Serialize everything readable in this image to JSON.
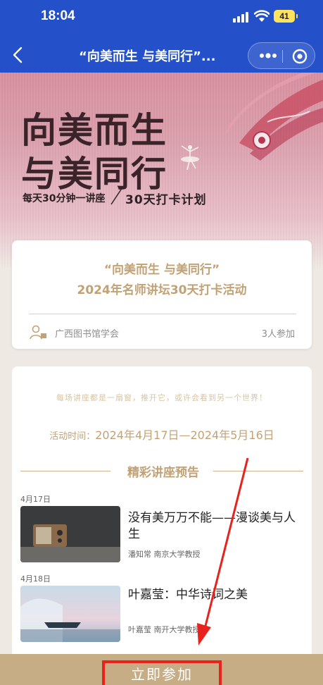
{
  "status": {
    "time": "18:04",
    "battery": "41"
  },
  "nav": {
    "title": "“向美而生 与美同行”..."
  },
  "banner": {
    "title_line1": "向美而生",
    "title_line2": "与美同行",
    "subtitle_left": "每天30分钟一讲座",
    "subtitle_right": "30天打卡计划"
  },
  "activity": {
    "title_line1": "“向美而生 与美同行”",
    "title_line2": "2024年名师讲坛30天打卡活动",
    "organizer": "广西图书馆学会",
    "participants": "3人参加"
  },
  "details": {
    "quote": "每场讲座都是一扇窗，推开它，或许会看到另一个世界！",
    "period_label": "活动时间：",
    "period_value": "2024年4月17日—2024年5月16日",
    "section_title": "精彩讲座预告",
    "lectures": [
      {
        "date": "4月17日",
        "title": "没有美万万不能——漫谈美与人生",
        "speaker": "潘知常 南京大学教授"
      },
      {
        "date": "4月18日",
        "title": "叶嘉莹：中华诗词之美",
        "speaker": "叶嘉莹 南开大学教授"
      }
    ]
  },
  "cta": {
    "label": "立即参加"
  },
  "colors": {
    "nav_blue": "#2450c9",
    "gold": "#c2a274",
    "cta_bar": "#c7ad86",
    "highlight_red": "#e8221c"
  }
}
